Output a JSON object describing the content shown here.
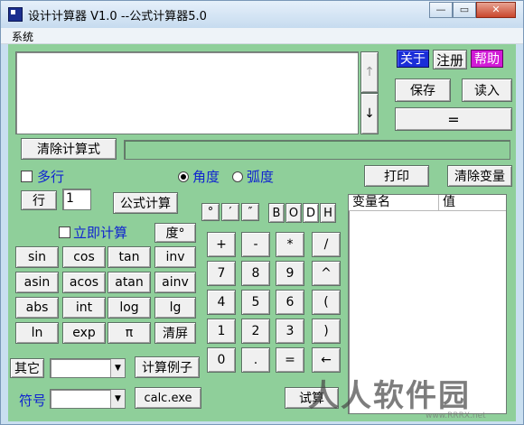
{
  "window": {
    "title": "设计计算器 V1.0 --公式计算器5.0",
    "minimize_label": "—",
    "restore_label": "▭",
    "close_label": "✕"
  },
  "menu": {
    "system": "系统"
  },
  "scroll": {
    "up": "↑",
    "down": "↓"
  },
  "toolbar": {
    "about": "关于",
    "register": "注册",
    "help": "帮助",
    "save": "保存",
    "load": "读入",
    "equals": "="
  },
  "formula": {
    "clear_label": "清除计算式",
    "status_text": ""
  },
  "options": {
    "multiline": "多行",
    "degree": "角度",
    "radian": "弧度",
    "print": "打印",
    "clear_vars": "清除变量",
    "row_label": "行",
    "row_value": "1",
    "formula_calc": "公式计算",
    "instant_calc": "立即计算",
    "degree_symbol": "度°"
  },
  "functions": [
    [
      "sin",
      "cos",
      "tan",
      "inv"
    ],
    [
      "asin",
      "acos",
      "atan",
      "ainv"
    ],
    [
      "abs",
      "int",
      "log",
      "lg"
    ],
    [
      "ln",
      "exp",
      "π",
      "清屏"
    ]
  ],
  "symbols_top": [
    "°",
    "′",
    "″"
  ],
  "base": [
    "B",
    "O",
    "D",
    "H"
  ],
  "keypad": [
    [
      "+",
      "-",
      "*",
      "/"
    ],
    [
      "7",
      "8",
      "9",
      "^"
    ],
    [
      "4",
      "5",
      "6",
      "("
    ],
    [
      "1",
      "2",
      "3",
      ")"
    ],
    [
      "0",
      ".",
      "=",
      "←"
    ]
  ],
  "other": {
    "other_label": "其它",
    "other_value": "",
    "examples": "计算例子",
    "symbol_label": "符号",
    "symbol_value": "",
    "calc_exe": "calc.exe",
    "test_btn": "试算"
  },
  "variables": {
    "col_name": "变量名",
    "col_value": "值"
  },
  "watermark": {
    "text": "人人软件园",
    "sub": "www.RRRX.net"
  }
}
